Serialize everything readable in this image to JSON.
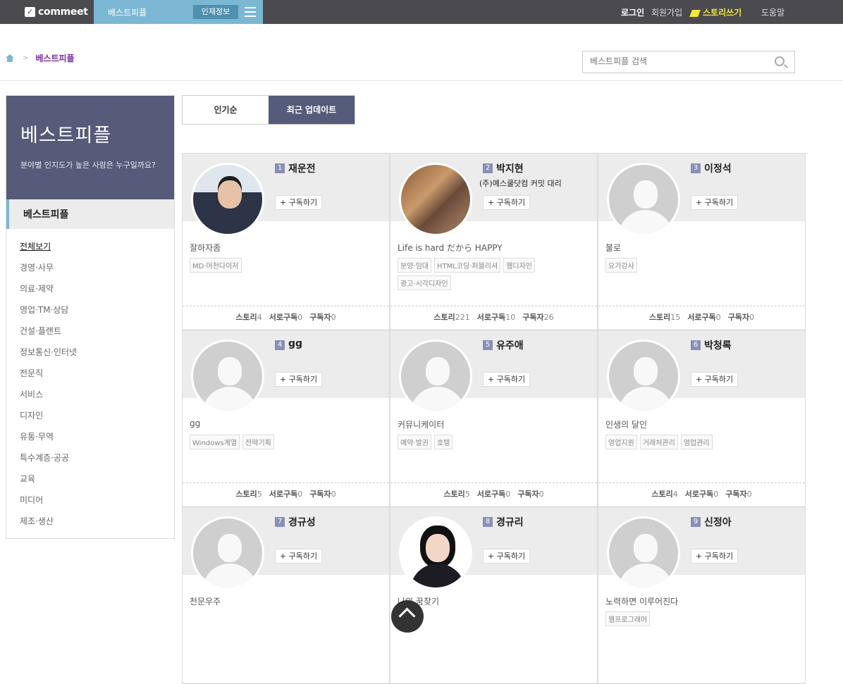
{
  "topbar": {
    "logo": "commeet",
    "tab_label": "베스트피플",
    "tab_badge": "인재정보",
    "login": "로그인",
    "join": "회원가입",
    "write": "스토리쓰기",
    "help": "도움말"
  },
  "breadcrumb": {
    "current": "베스트피플",
    "sep": ">"
  },
  "search": {
    "placeholder": "베스트피플 검색"
  },
  "sidebar": {
    "title": "베스트피플",
    "desc": "분야별 인지도가 높은 사람은 누구일까요?",
    "section": "베스트피플",
    "items": [
      "전체보기",
      "경영·사무",
      "의료·제약",
      "영업·TM·상담",
      "건설·플랜트",
      "정보통신·인터넷",
      "전문직",
      "서비스",
      "디자인",
      "유통·무역",
      "특수계층·공공",
      "교육",
      "미디어",
      "제조·생산"
    ]
  },
  "tabs": [
    "인기순",
    "최근 업데이트"
  ],
  "labels": {
    "subscribe": "구독하기",
    "story": "스토리",
    "mutual": "서로구독",
    "subscribers": "구독자"
  },
  "people": [
    {
      "rank": "1",
      "name": "재운전",
      "job": "",
      "intro": "잘하자좀",
      "tags": [
        "MD·머천다이저"
      ],
      "story": "4",
      "mutual": "0",
      "subs": "0",
      "photo": "man-photo"
    },
    {
      "rank": "2",
      "name": "박지현",
      "job": "(주)예스쿨닷컴 커밋 대리",
      "intro": "Life is hard だから HAPPY",
      "tags": [
        "분양·임대",
        "HTML코딩·퍼블리셔",
        "웹디자인",
        "광고·시각디자인"
      ],
      "story": "221",
      "mutual": "10",
      "subs": "26",
      "photo": "woman-photo"
    },
    {
      "rank": "3",
      "name": "이정석",
      "job": "",
      "intro": "불로",
      "tags": [
        "요가강사"
      ],
      "story": "15",
      "mutual": "0",
      "subs": "0",
      "photo": ""
    },
    {
      "rank": "4",
      "name": "gg",
      "job": "",
      "intro": "gg",
      "tags": [
        "Windows계열",
        "전략기획"
      ],
      "story": "5",
      "mutual": "0",
      "subs": "0",
      "photo": ""
    },
    {
      "rank": "5",
      "name": "유주애",
      "job": "",
      "intro": "커뮤니케이터",
      "tags": [
        "예약·발권",
        "호텔"
      ],
      "story": "5",
      "mutual": "0",
      "subs": "0",
      "photo": ""
    },
    {
      "rank": "6",
      "name": "박청록",
      "job": "",
      "intro": "인생의 달인",
      "tags": [
        "영업지원",
        "거래처관리",
        "영업관리"
      ],
      "story": "4",
      "mutual": "0",
      "subs": "0",
      "photo": ""
    },
    {
      "rank": "7",
      "name": "경규성",
      "job": "",
      "intro": "천문우주",
      "tags": [],
      "story": "",
      "mutual": "",
      "subs": "",
      "photo": ""
    },
    {
      "rank": "8",
      "name": "경규리",
      "job": "",
      "intro": "나의 꿈찾기",
      "tags": [],
      "story": "",
      "mutual": "",
      "subs": "",
      "photo": "girl-photo"
    },
    {
      "rank": "9",
      "name": "신정아",
      "job": "",
      "intro": "노력하면 이루어진다",
      "tags": [
        "웹프로그래머"
      ],
      "story": "",
      "mutual": "",
      "subs": "",
      "photo": ""
    }
  ]
}
